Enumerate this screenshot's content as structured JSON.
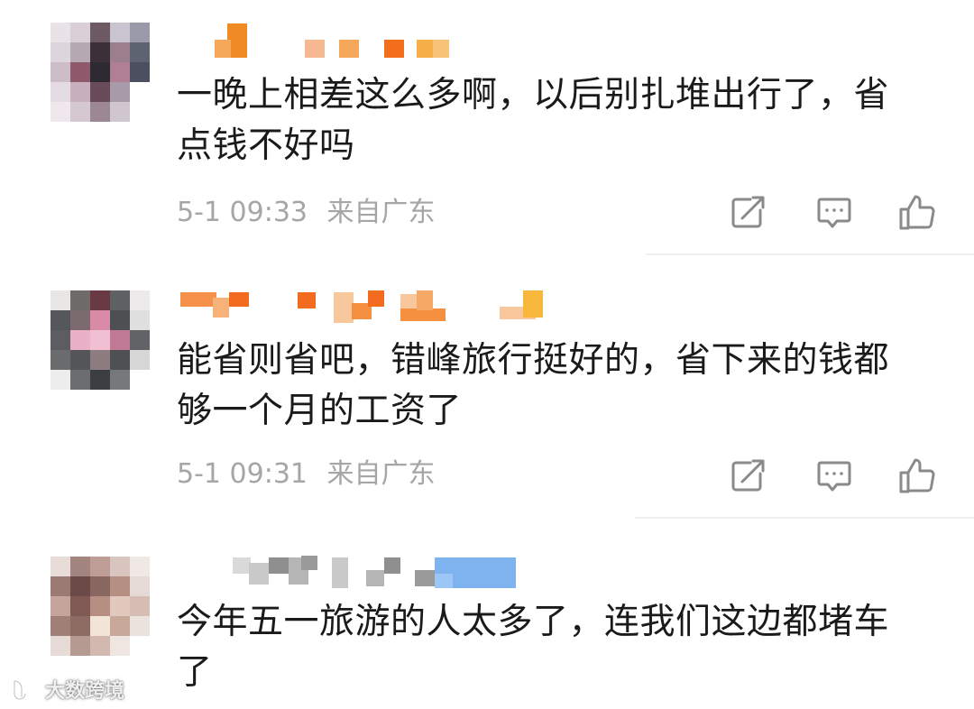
{
  "comments": [
    {
      "text": "一晚上相差这么多啊，以后别扎堆出行了，省\n点钱不好吗",
      "time": "5-1 09:33",
      "location": "来自广东",
      "avatar_colors": [
        "#e7e3e6",
        "#d9cfd4",
        "#6d5a62",
        "#c8c4d0",
        "#9a9aa8",
        "#dcd5db",
        "#b7a9b3",
        "#3c3038",
        "#9c7f8d",
        "#5d6370",
        "#cdbdc7",
        "#8e5a6c",
        "#2e2a33",
        "#b07f95",
        "#4c4f60",
        "#e5dce3",
        "#c9b0bf",
        "#6a4b5a",
        "#a89aa9",
        "#ffffff",
        "#efe7ec",
        "#d6c8d1",
        "#9b8795",
        "#cfc6cf",
        "#ffffff"
      ],
      "name_colors": [
        "#f08a24",
        "#f5a85a",
        "#f39a3a",
        "#f26d1c",
        "#f6b04a",
        "#f8c278"
      ]
    },
    {
      "text": "能省则省吧，错峰旅行挺好的，省下来的钱都\n够一个月的工资了",
      "time": "5-1 09:31",
      "location": "来自广东",
      "avatar_colors": [
        "#e9e7e6",
        "#6f6b69",
        "#6a3a44",
        "#5f6162",
        "#eceaea",
        "#55575a",
        "#7b6a6e",
        "#d98aa7",
        "#4d4f52",
        "#e0dfdf",
        "#5c5d60",
        "#eab0c6",
        "#f2bfd2",
        "#c07a93",
        "#616366",
        "#6b6c6e",
        "#55565a",
        "#8d7d80",
        "#4e5053",
        "#d8d7d7",
        "#eeeded",
        "#6c6d70",
        "#3d3e42",
        "#77787b",
        "#ffffff"
      ],
      "name_colors": [
        "#f5904a",
        "#f7b27a",
        "#f26b1e",
        "#f59040",
        "#f8c89c",
        "#f6a865",
        "#f7b73a"
      ]
    },
    {
      "text": "今年五一旅游的人太多了，连我们这边都堵车\n了",
      "time": "",
      "location": "",
      "avatar_colors": [
        "#e8dcd8",
        "#a3857f",
        "#bd9d96",
        "#d9c5c0",
        "#f0e8e5",
        "#9b7a74",
        "#6c4a47",
        "#8a6660",
        "#b58e84",
        "#e6dad6",
        "#c4a49b",
        "#7f5a54",
        "#b78e84",
        "#e2c9bd",
        "#d5bdb3",
        "#a07f77",
        "#8e6c64",
        "#f3e4d8",
        "#c9a89c",
        "#ece2dd",
        "#e6dbd6",
        "#b59a92",
        "#d1b9b0",
        "#efe6e2",
        "#ffffff"
      ],
      "name_colors": [
        "#c9c9c9",
        "#8f8f8f",
        "#b5b5b5",
        "#9a9a9a",
        "#7fb3f0",
        "#9cc6f5"
      ]
    }
  ],
  "actions": {
    "share_icon": "share-icon",
    "comment_icon": "comment-icon",
    "like_icon": "thumbs-up-icon"
  },
  "watermark": {
    "text": "大数跨境"
  }
}
